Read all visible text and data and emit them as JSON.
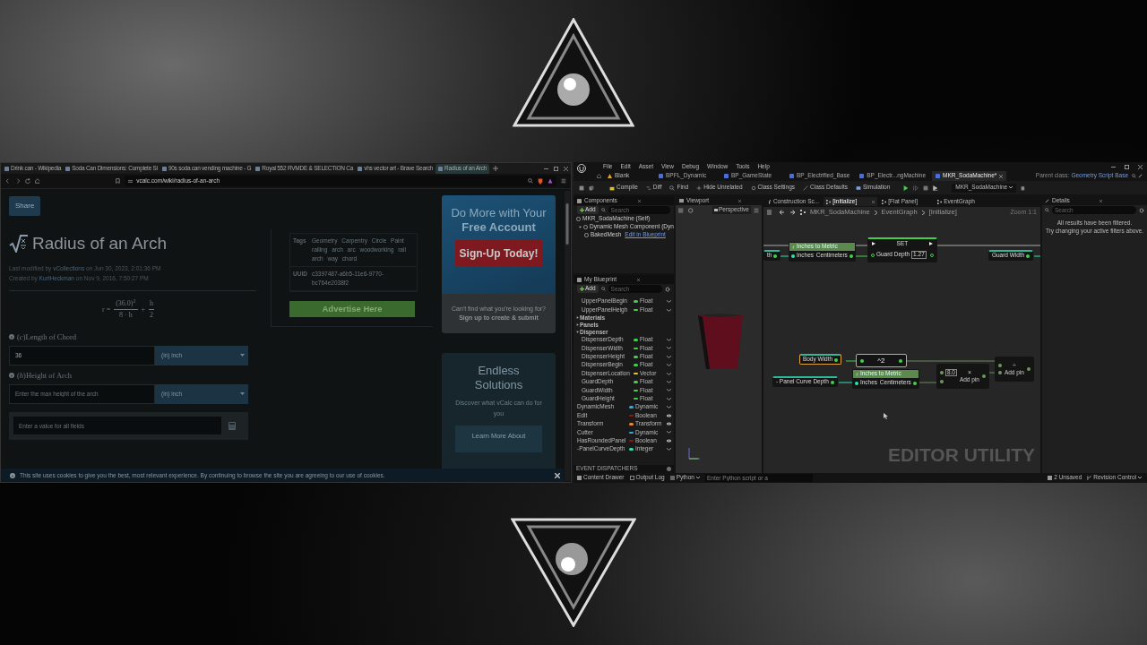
{
  "browser": {
    "tabs": [
      {
        "title": "Drink can - Wikipedia",
        "selected": false
      },
      {
        "title": "Soda Can Dimensions: Complete Si",
        "selected": false
      },
      {
        "title": "90s soda can vending machine - G",
        "selected": false
      },
      {
        "title": "Royal 552 RVMDE & SELECTION Ca",
        "selected": false
      },
      {
        "title": "vhs vector art - Brave Search",
        "selected": false
      },
      {
        "title": "Radius of an Arch",
        "selected": true
      }
    ],
    "url": "vcalc.com/wiki/radius-of-an-arch",
    "share": "Share",
    "title": "Radius of an Arch",
    "meta": [
      {
        "prefix": "Last modified by ",
        "author": "vCollections",
        "suffix": " on Jun 30, 2023, 2:01:36 PM"
      },
      {
        "prefix": "Created by ",
        "author": "KurtHeckman",
        "suffix": " on Nov 9, 2016, 7:50:27 PM"
      }
    ],
    "formula": {
      "lhs": "r =",
      "numerator": "(36.0)$^{2}$",
      "denominator": "8 · h",
      "operator": "+",
      "numerator_2": "h",
      "denominator_2": "2"
    },
    "fields": [
      {
        "label": "(*c*)Length of Chord",
        "value": "36",
        "unit": "(in) inch"
      },
      {
        "label": "(*h*)Height of Arch",
        "placeholder": "Enter the max height of the arch",
        "unit": "(in) inch"
      }
    ],
    "result": {
      "placeholder": "Enter a value for all fields"
    },
    "info": [
      {
        "key": "Tags",
        "value": "Geometry Carpentry Circle Paint railing arch arc woodworking rail arch way chord"
      },
      {
        "key": "UUID",
        "value": "c3397487-a6b5-11e6-9770-bc764e2038f2"
      }
    ],
    "advertise": "Advertise Here",
    "promo": {
      "title": "Do More with Your **Free Account**",
      "button": "Sign-Up Today!",
      "text": "Can't find what you're looking for? **Sign up to create & submit**"
    },
    "promo_2": {
      "title": "Endless Solutions",
      "text": "Discover what vCalc can do for you",
      "button": "Learn More About"
    },
    "cookie": "This site uses cookies to give you the best, most relevant experience. By continuing to browse the site you are agreeing to our use of cookies."
  },
  "editor": {
    "menu": [
      "File",
      "Edit",
      "Asset",
      "View",
      "Debug",
      "Window",
      "Tools",
      "Help"
    ],
    "level": "Blank",
    "tabs": [
      {
        "title": "BPFL_Dynamic",
        "selected": false
      },
      {
        "title": "BP_GameState",
        "selected": false
      },
      {
        "title": "BP_Electrified_Base",
        "selected": false
      },
      {
        "title": "BP_Electr...ngMachine",
        "selected": false
      },
      {
        "title": "MKR_SodaMachine*",
        "selected": true
      }
    ],
    "parent_class_label": "Parent class:",
    "parent_class": "Geometry Script Base",
    "toolbar": [
      "Compile",
      "Diff",
      "Find",
      "Hide Unrelated",
      "Class Settings",
      "Class Defaults",
      "Simulation"
    ],
    "debug_object": "MKR_SodaMachine",
    "components": {
      "title": "Components",
      "add": "Add",
      "search": {
        "placeholder": "Search"
      },
      "tree": [
        {
          "label": "MKR_SodaMachine (Self)",
          "children": [
            {
              "label": "Dynamic Mesh Component (Dyn",
              "expanded": true,
              "children": [
                {
                  "label": "BakedMesh",
                  "link": "Edit in Blueprint"
                }
              ]
            }
          ]
        }
      ]
    },
    "blueprint": {
      "title": "My Blueprint",
      "add": "Add",
      "search": {
        "placeholder": "Search"
      },
      "items": [
        {
          "kind": "variable",
          "name": "UpperPanelBegin",
          "type": "Float",
          "color": "#3fd14a",
          "public": false
        },
        {
          "kind": "variable",
          "name": "UpperPanelHeigh",
          "type": "Float",
          "color": "#3fd14a",
          "public": false
        },
        {
          "kind": "category",
          "name": "Materials",
          "expanded": false
        },
        {
          "kind": "category",
          "name": "Panels",
          "expanded": false
        },
        {
          "kind": "category",
          "name": "Dispenser",
          "expanded": true,
          "children": [
            {
              "kind": "variable",
              "name": "DispenserDepth",
              "type": "Float",
              "color": "#3fd14a",
              "public": false
            },
            {
              "kind": "variable",
              "name": "DispenserWidth",
              "type": "Float",
              "color": "#3fd14a",
              "public": false
            },
            {
              "kind": "variable",
              "name": "DispenserHeight",
              "type": "Float",
              "color": "#3fd14a",
              "public": false
            },
            {
              "kind": "variable",
              "name": "DispenserBegin",
              "type": "Float",
              "color": "#3fd14a",
              "public": false
            },
            {
              "kind": "variable",
              "name": "DispenserLocation",
              "type": "Vector",
              "color": "#e8c630",
              "public": false
            },
            {
              "kind": "variable",
              "name": "GuardDepth",
              "type": "Float",
              "color": "#3fd14a",
              "public": false
            },
            {
              "kind": "variable",
              "name": "GuardWidth",
              "type": "Float",
              "color": "#3fd14a",
              "public": false
            },
            {
              "kind": "variable",
              "name": "GuardHeight",
              "type": "Float",
              "color": "#3fd14a",
              "public": false
            }
          ]
        },
        {
          "kind": "variable",
          "name": "DynamicMesh",
          "type": "Dynamic",
          "color": "#2fa8e0",
          "public": false
        },
        {
          "kind": "variable",
          "name": "Edit",
          "type": "Boolean",
          "color": "#8a1a1a",
          "public": true
        },
        {
          "kind": "variable",
          "name": "Transform",
          "type": "Transform",
          "color": "#f0852a",
          "public": true
        },
        {
          "kind": "variable",
          "name": "Cutter",
          "type": "Dynamic",
          "color": "#2fa8e0",
          "public": false
        },
        {
          "kind": "variable",
          "name": "HasRoundedPanel",
          "type": "Boolean",
          "color": "#8a1a1a",
          "public": true
        },
        {
          "kind": "variable",
          "name": "-PanelCurveDepth",
          "type": "Integer",
          "color": "#2fe0b0",
          "public": false
        }
      ],
      "section": "EVENT DISPATCHERS"
    },
    "viewport": {
      "title": "Viewport",
      "view_mode": "Perspective"
    },
    "graph": {
      "tabs": [
        {
          "title": "Construction Sc...",
          "kind": "function",
          "selected": false
        },
        {
          "title": "[Initialize]",
          "kind": "graph",
          "selected": true
        },
        {
          "title": "[Flat Panel]",
          "kind": "graph",
          "selected": false
        },
        {
          "title": "EventGraph",
          "kind": "graph",
          "selected": false
        }
      ],
      "breadcrumb": [
        "MKR_SodaMachine",
        "EventGraph",
        "[Initialize]"
      ],
      "zoom": "Zoom 1:1",
      "nodes": [
        {
          "kind": "getter",
          "label": "th",
          "selected": false
        },
        {
          "kind": "function",
          "title": "Inches to Metric",
          "input": "Inches",
          "output": "Centimeters",
          "selected": false
        },
        {
          "kind": "set",
          "title": "SET",
          "pin": "Guard Depth",
          "value": "1.27",
          "selected": false
        },
        {
          "kind": "getter",
          "label": "Guard Width",
          "selected": false
        },
        {
          "kind": "getter",
          "label": "Body Width",
          "selected": true
        },
        {
          "kind": "operator",
          "symbol": "^2",
          "selected": true
        },
        {
          "kind": "getter",
          "label": "- Panel Curve Depth",
          "selected": false
        },
        {
          "kind": "function",
          "title": "Inches to Metric",
          "input": "Inches",
          "output": "Centimeters",
          "selected": false
        },
        {
          "kind": "math",
          "symbol": "×",
          "value": "8.0",
          "add_pin": "Add pin",
          "selected": false
        },
        {
          "kind": "math",
          "symbol": "÷",
          "add_pin": "Add pin",
          "selected": false
        }
      ],
      "watermark": "EDITOR UTILITY"
    },
    "details": {
      "title": "Details",
      "search": {
        "placeholder": "Search"
      },
      "message": [
        "All results have been filtered.",
        "Try changing your active filters above."
      ]
    },
    "status": {
      "content_drawer": "Content Drawer",
      "output_log": "Output Log",
      "console": "Python",
      "console_placeholder": "Enter Python script or a",
      "unsaved": "2 Unsaved",
      "revision": "Revision Control"
    }
  }
}
